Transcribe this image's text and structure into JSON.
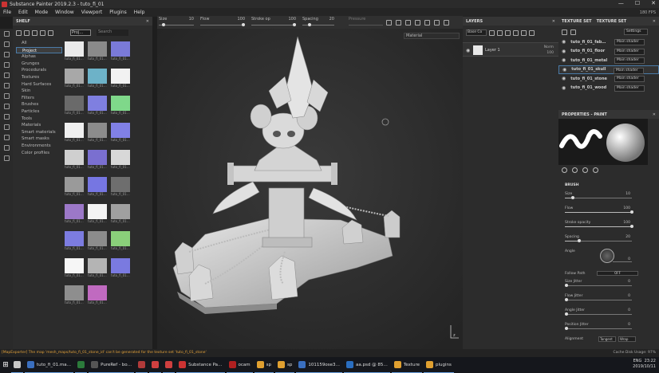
{
  "app": {
    "title": "Substance Painter 2019.2.3 - tuto_fi_01",
    "window_controls": [
      "—",
      "☐",
      "✕"
    ]
  },
  "menu": [
    "File",
    "Edit",
    "Mode",
    "Window",
    "Viewport",
    "Plugins",
    "Help"
  ],
  "fps": "180 FPS",
  "toolbar": {
    "size": {
      "label": "Size",
      "value": "10",
      "level": 0.1
    },
    "flow": {
      "label": "Flow",
      "value": "100",
      "level": 1.0
    },
    "stroke": {
      "label": "Stroke op",
      "value": "100",
      "level": 1.0
    },
    "spacing": {
      "label": "Spacing",
      "value": "20",
      "level": 0.2
    },
    "pressure": {
      "label": "Pressure",
      "value": "0"
    }
  },
  "shelf": {
    "title": "SHELF",
    "filter": "Proj…",
    "search_placeholder": "Search",
    "categories": [
      "All",
      "Project",
      "Alphas",
      "Grunges",
      "Procedurals",
      "Textures",
      "Hard Surfaces",
      "Skin",
      "Filters",
      "Brushes",
      "Particles",
      "Tools",
      "Materials",
      "Smart materials",
      "Smart masks",
      "Environments",
      "Color profiles"
    ],
    "selected_category": "Project",
    "thumbnails": [
      {
        "name": "tuto_fi_01…",
        "color": "#eaeaea"
      },
      {
        "name": "tuto_fi_01…",
        "color": "#8a8a8a"
      },
      {
        "name": "tuto_fi_01…",
        "color": "#7a7ad8"
      },
      {
        "name": "tuto_fi_01…",
        "color": "#a8a8a8"
      },
      {
        "name": "tuto_fi_01…",
        "color": "#6db2c8"
      },
      {
        "name": "tuto_fi_01…",
        "color": "#f2f2f2"
      },
      {
        "name": "tuto_fi_01…",
        "color": "#6a6a6a"
      },
      {
        "name": "tuto_fi_01…",
        "color": "#7f7fe0"
      },
      {
        "name": "tuto_fi_01…",
        "color": "#7fd88a"
      },
      {
        "name": "tuto_fi_01…",
        "color": "#f0f0f0"
      },
      {
        "name": "tuto_fi_01…",
        "color": "#8c8c8c"
      },
      {
        "name": "tuto_fi_01…",
        "color": "#8080e6"
      },
      {
        "name": "tuto_fi_01…",
        "color": "#cfcfcf"
      },
      {
        "name": "tuto_fi_01…",
        "color": "#7a6fd0"
      },
      {
        "name": "tuto_fi_01…",
        "color": "#d8d8d8"
      },
      {
        "name": "tuto_fi_01…",
        "color": "#9a9a9a"
      },
      {
        "name": "tuto_fi_01…",
        "color": "#7676e2"
      },
      {
        "name": "tuto_fi_01…",
        "color": "#6e6e6e"
      },
      {
        "name": "tuto_fi_01…",
        "color": "#9c78c8"
      },
      {
        "name": "tuto_fi_01…",
        "color": "#f4f4f4"
      },
      {
        "name": "tuto_fi_01…",
        "color": "#a0a0a0"
      },
      {
        "name": "tuto_fi_01…",
        "color": "#7c7ce0"
      },
      {
        "name": "tuto_fi_01…",
        "color": "#8c8c8c"
      },
      {
        "name": "tuto_fi_01…",
        "color": "#8ad07a"
      },
      {
        "name": "tuto_fi_01…",
        "color": "#f6f6f6"
      },
      {
        "name": "tuto_fi_01…",
        "color": "#b4b4b4"
      },
      {
        "name": "tuto_fi_01…",
        "color": "#7a7ae0"
      },
      {
        "name": "tuto_fi_01…",
        "color": "#8e8e8e"
      },
      {
        "name": "tuto_fi_01…",
        "color": "#c06ac0"
      }
    ]
  },
  "viewport": {
    "material_mode": "Material"
  },
  "layers": {
    "title": "LAYERS",
    "blend": "Base Co",
    "layer": {
      "name": "Layer 1",
      "blend": "Norm",
      "opacity": "100"
    }
  },
  "texture_sets": {
    "tab1": "TEXTURE SET",
    "tab2": "TEXTURE SET",
    "settings": "Settings",
    "items": [
      {
        "name": "tuto_fi_01_fab…",
        "shader": "Main shader"
      },
      {
        "name": "tuto_fi_01_floor",
        "shader": "Main shader"
      },
      {
        "name": "tuto_fi_01_metal",
        "shader": "Main shader"
      },
      {
        "name": "tuto_fi_01_skull",
        "shader": "Main shader"
      },
      {
        "name": "tuto_fi_01_stone",
        "shader": "Main shader"
      },
      {
        "name": "tuto_fi_01_wood",
        "shader": "Main shader"
      }
    ],
    "selected": "tuto_fi_01_skull"
  },
  "properties": {
    "title": "PROPERTIES - PAINT",
    "section": "BRUSH",
    "params": [
      {
        "label": "Size",
        "value": "10",
        "level": 0.1
      },
      {
        "label": "Flow",
        "value": "100",
        "level": 1.0
      },
      {
        "label": "Stroke opacity",
        "value": "100",
        "level": 1.0
      },
      {
        "label": "Spacing",
        "value": "20",
        "level": 0.2
      },
      {
        "label": "Angle",
        "value": "0",
        "level": 0
      }
    ],
    "follow_path": {
      "label": "Follow Path",
      "value": "OFF"
    },
    "jitters": [
      {
        "label": "Size Jitter",
        "value": "0"
      },
      {
        "label": "Flow Jitter",
        "value": "0"
      },
      {
        "label": "Angle Jitter",
        "value": "0"
      },
      {
        "label": "Position Jitter",
        "value": "0"
      }
    ],
    "alignment": {
      "label": "Alignment",
      "mode": "Tangent",
      "wrap": "Wrap"
    }
  },
  "status": {
    "message": "[MapExporter] The map 'mesh_maps/tuto_fi_01_stone_id' can't be generated for the texture set 'tuto_fi_01_stone'",
    "cache": "Cache Disk Usage: 97%"
  },
  "taskbar": {
    "items": [
      {
        "label": "",
        "color": "#c7c7c7"
      },
      {
        "label": "tuto_fi_01.ma…",
        "color": "#3a6fbf"
      },
      {
        "label": "",
        "color": "#2b7a3b"
      },
      {
        "label": "PureRef - bo…",
        "color": "#555"
      },
      {
        "label": "",
        "color": "#b03a3a"
      },
      {
        "label": "",
        "color": "#d04040"
      },
      {
        "label": "",
        "color": "#cf3f3f"
      },
      {
        "label": "Substance Pa…",
        "color": "#c33"
      },
      {
        "label": "ocam",
        "color": "#b02020"
      },
      {
        "label": "sp",
        "color": "#e0a030"
      },
      {
        "label": "sp",
        "color": "#e0a030"
      },
      {
        "label": "101159ose3…",
        "color": "#3a6fbf"
      },
      {
        "label": "aa.psd @ 85…",
        "color": "#2a6ec0"
      },
      {
        "label": "Texture",
        "color": "#e0a030"
      },
      {
        "label": "plugins",
        "color": "#e0a030"
      }
    ],
    "tray": {
      "lang": "ENG",
      "time": "23:22",
      "date": "2019/10/11"
    }
  }
}
